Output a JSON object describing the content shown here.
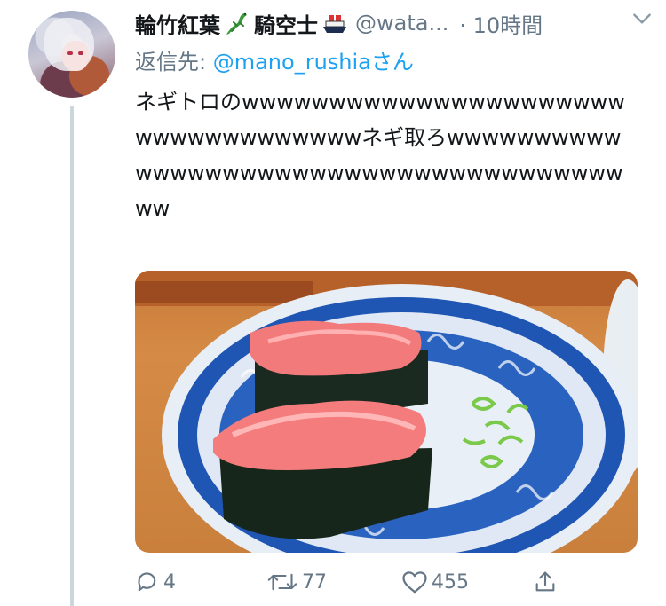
{
  "tweet": {
    "display_name": "輪竹紅葉",
    "name_suffix": "騎空士",
    "handle": "@wata...",
    "time": "· 10時間",
    "reply_prefix": "返信先: ",
    "reply_mention": "@mano_rushiaさん",
    "text": "ネギトロのwwwwwwwwwwwwwwwwwwwwwwwwwwwwwwwwwwwネギ取ろwwwwwwwwwwwwwwwwwwwwwwwwwwwwwwwwwwwwwwww",
    "photo_alt": "sushi gunkan negitoro on blue plate"
  },
  "actions": {
    "replies": "4",
    "retweets": "77",
    "likes": "455"
  },
  "icons": {
    "lizard": "lizard-emoji",
    "ship": "ship-emoji",
    "chevron": "chevron-down-icon",
    "reply": "reply-icon",
    "retweet": "retweet-icon",
    "like": "heart-icon",
    "share": "share-icon"
  },
  "colors": {
    "link": "#1da1f2",
    "secondary": "#657786",
    "thread_line": "#ccd6dd"
  }
}
